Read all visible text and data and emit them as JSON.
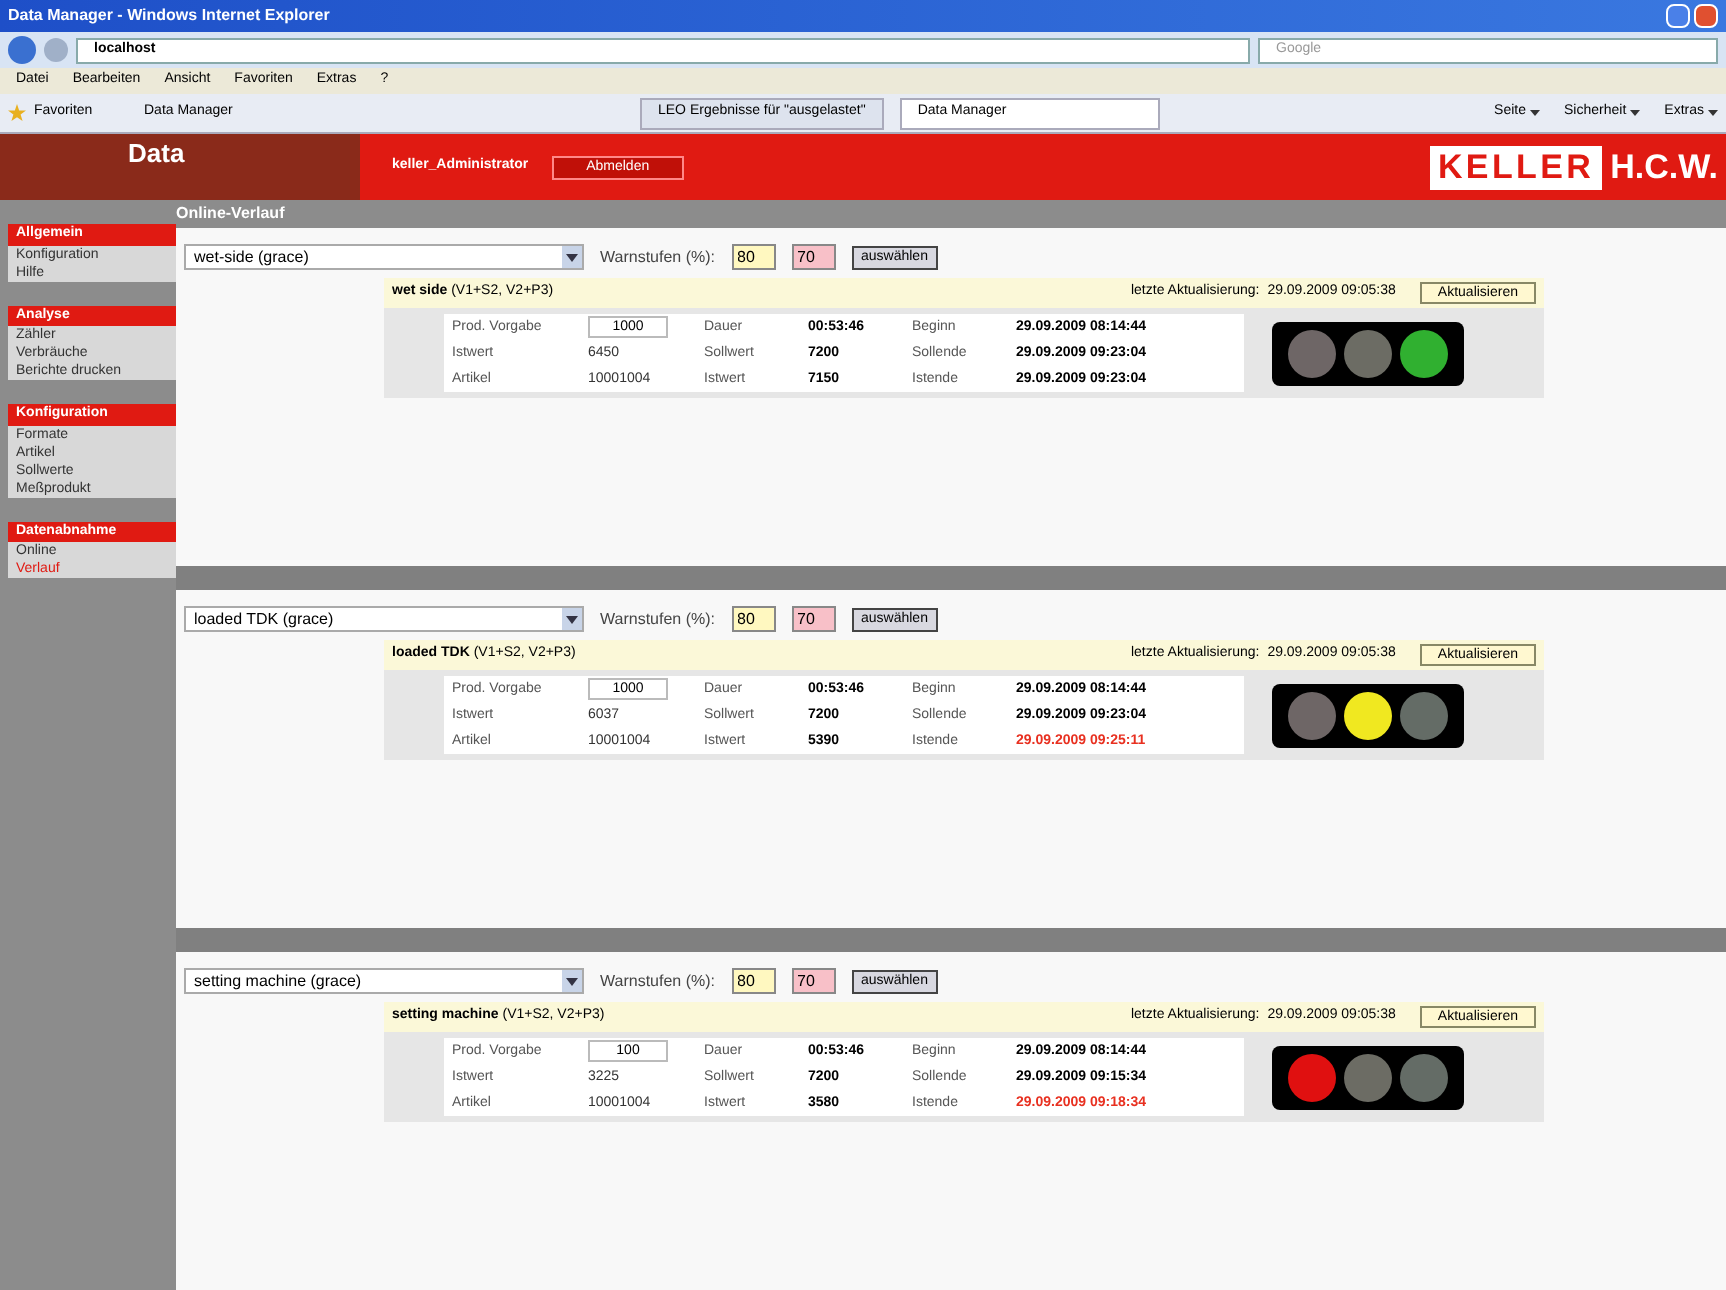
{
  "window": {
    "title": "Data Manager - Windows Internet Explorer"
  },
  "address": {
    "value": "localhost"
  },
  "search": {
    "placeholder": "Google"
  },
  "menu": [
    "Datei",
    "Bearbeiten",
    "Ansicht",
    "Favoriten",
    "Extras",
    "?"
  ],
  "favorites": {
    "label": "Favoriten",
    "link": "Data Manager"
  },
  "tabs": [
    {
      "label": "LEO Ergebnisse für \"ausgelastet\"",
      "selected": false
    },
    {
      "label": "Data Manager",
      "selected": true
    }
  ],
  "commands": [
    "Seite",
    "Sicherheit",
    "Extras"
  ],
  "app": {
    "logo": "Data",
    "user": "keller_Administrator",
    "logout": "Abmelden",
    "brand_1": "KELLER",
    "brand_2": "H.C.W.",
    "page_title": "Online-Verlauf"
  },
  "sidebar": [
    {
      "title": "Allgemein",
      "items": [
        {
          "label": "Konfiguration",
          "selected": false
        },
        {
          "label": "Hilfe",
          "selected": false
        }
      ]
    },
    {
      "title": "Analyse",
      "items": [
        {
          "label": "Zähler",
          "selected": false
        },
        {
          "label": "Verbräuche",
          "selected": false
        },
        {
          "label": "Berichte drucken",
          "selected": false
        }
      ]
    },
    {
      "title": "Konfiguration",
      "items": [
        {
          "label": "Formate",
          "selected": false
        },
        {
          "label": "Artikel",
          "selected": false
        },
        {
          "label": "Sollwerte",
          "selected": false
        },
        {
          "label": "Meßprodukt",
          "selected": false
        }
      ]
    },
    {
      "title": "Datenabnahme",
      "items": [
        {
          "label": "Online",
          "selected": false
        },
        {
          "label": "Verlauf",
          "selected": true
        }
      ]
    }
  ],
  "panels": [
    {
      "select": "wet-side (grace)",
      "warn_label": "Warnstufen (%):",
      "warn_1": "80",
      "warn_2": "70",
      "apply": "auswählen",
      "name": "wet side",
      "detail": "(V1+S2, V2+P3)",
      "update_label": "letzte Aktualisierung:",
      "update_time": "29.09.2009 09:05:38",
      "refresh": "Aktualisieren",
      "lamps": [
        {
          "kind": "red",
          "on": false
        },
        {
          "kind": "yellow",
          "on": false
        },
        {
          "kind": "green",
          "on": true
        }
      ],
      "rows": [
        {
          "l1": "Prod. Vorgabe",
          "v1": "1000",
          "input": true,
          "l2": "Dauer",
          "v2": "00:53:46",
          "l3": "Beginn",
          "v3": "29.09.2009 08:14:44",
          "late": false
        },
        {
          "l1": "Istwert",
          "v1": "6450",
          "input": false,
          "l2": "Sollwert",
          "v2": "7200",
          "l3": "Sollende",
          "v3": "29.09.2009 09:23:04",
          "late": false
        },
        {
          "l1": "Artikel",
          "v1": "10001004",
          "input": false,
          "l2": "Istwert",
          "v2": "7150",
          "l3": "Istende",
          "v3": "29.09.2009 09:23:04",
          "late": false
        }
      ]
    },
    {
      "select": "loaded TDK (grace)",
      "warn_label": "Warnstufen (%):",
      "warn_1": "80",
      "warn_2": "70",
      "apply": "auswählen",
      "name": "loaded TDK",
      "detail": "(V1+S2, V2+P3)",
      "update_label": "letzte Aktualisierung:",
      "update_time": "29.09.2009 09:05:38",
      "refresh": "Aktualisieren",
      "lamps": [
        {
          "kind": "red",
          "on": false
        },
        {
          "kind": "yellow",
          "on": true
        },
        {
          "kind": "green",
          "on": false
        }
      ],
      "rows": [
        {
          "l1": "Prod. Vorgabe",
          "v1": "1000",
          "input": true,
          "l2": "Dauer",
          "v2": "00:53:46",
          "l3": "Beginn",
          "v3": "29.09.2009 08:14:44",
          "late": false
        },
        {
          "l1": "Istwert",
          "v1": "6037",
          "input": false,
          "l2": "Sollwert",
          "v2": "7200",
          "l3": "Sollende",
          "v3": "29.09.2009 09:23:04",
          "late": false
        },
        {
          "l1": "Artikel",
          "v1": "10001004",
          "input": false,
          "l2": "Istwert",
          "v2": "5390",
          "l3": "Istende",
          "v3": "29.09.2009 09:25:11",
          "late": true
        }
      ]
    },
    {
      "select": "setting machine (grace)",
      "warn_label": "Warnstufen (%):",
      "warn_1": "80",
      "warn_2": "70",
      "apply": "auswählen",
      "name": "setting machine",
      "detail": "(V1+S2, V2+P3)",
      "update_label": "letzte Aktualisierung:",
      "update_time": "29.09.2009 09:05:38",
      "refresh": "Aktualisieren",
      "lamps": [
        {
          "kind": "red",
          "on": true
        },
        {
          "kind": "yellow",
          "on": false
        },
        {
          "kind": "green",
          "on": false
        }
      ],
      "rows": [
        {
          "l1": "Prod. Vorgabe",
          "v1": "100",
          "input": true,
          "l2": "Dauer",
          "v2": "00:53:46",
          "l3": "Beginn",
          "v3": "29.09.2009 08:14:44",
          "late": false
        },
        {
          "l1": "Istwert",
          "v1": "3225",
          "input": false,
          "l2": "Sollwert",
          "v2": "7200",
          "l3": "Sollende",
          "v3": "29.09.2009 09:15:34",
          "late": false
        },
        {
          "l1": "Artikel",
          "v1": "10001004",
          "input": false,
          "l2": "Istwert",
          "v2": "3580",
          "l3": "Istende",
          "v3": "29.09.2009 09:18:34",
          "late": true
        }
      ]
    }
  ]
}
